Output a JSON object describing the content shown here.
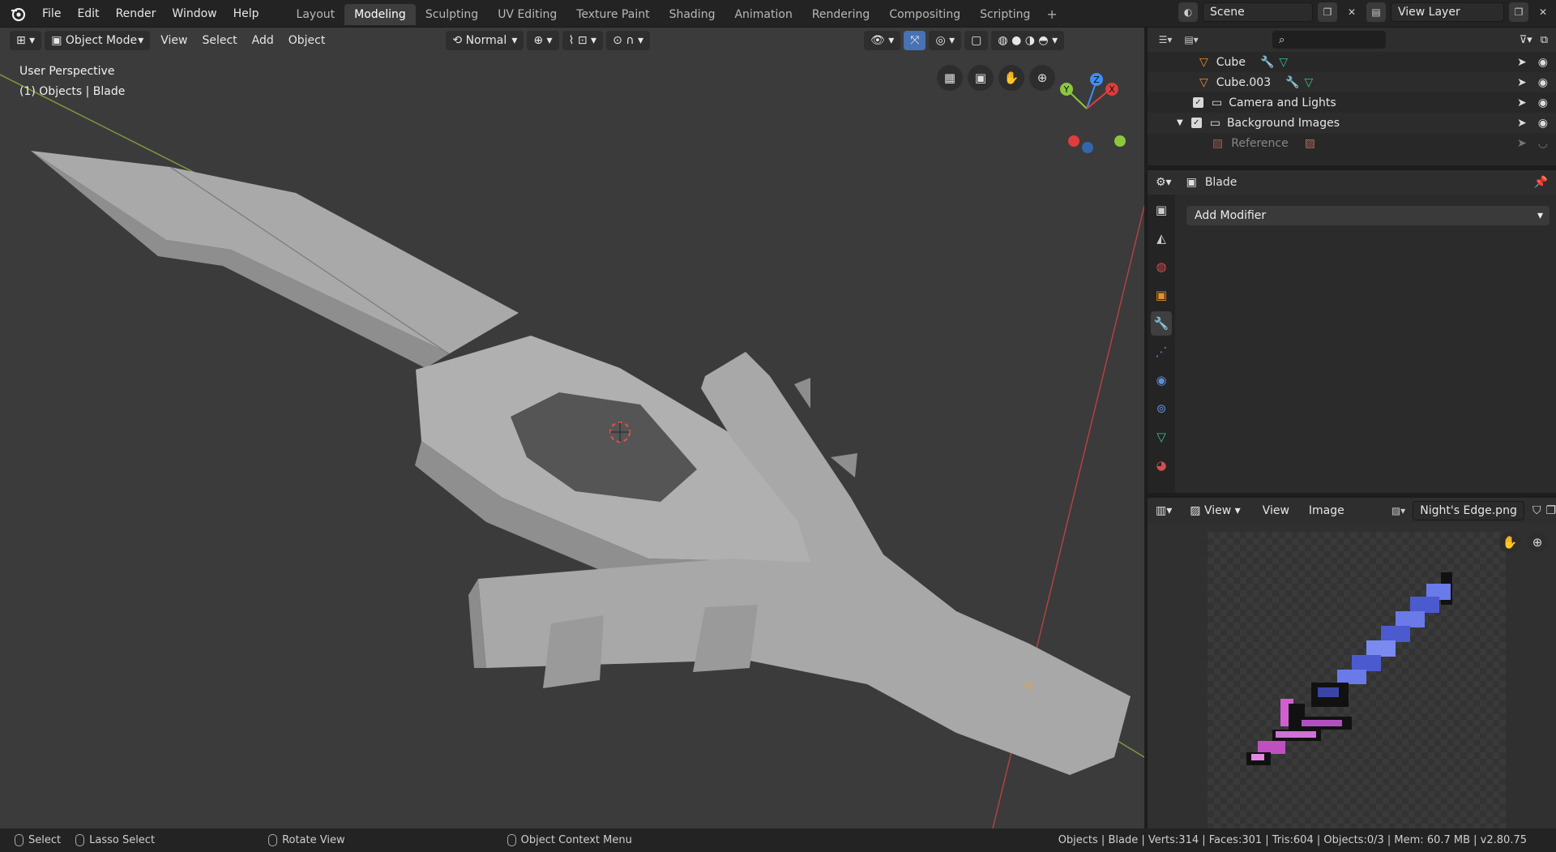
{
  "menu": {
    "file": "File",
    "edit": "Edit",
    "render": "Render",
    "window": "Window",
    "help": "Help"
  },
  "workspaces": [
    "Layout",
    "Modeling",
    "Sculpting",
    "UV Editing",
    "Texture Paint",
    "Shading",
    "Animation",
    "Rendering",
    "Compositing",
    "Scripting"
  ],
  "active_workspace": "Modeling",
  "scene": {
    "name": "Scene",
    "view_layer": "View Layer"
  },
  "viewport": {
    "mode": "Object Mode",
    "menus": {
      "view": "View",
      "select": "Select",
      "add": "Add",
      "object": "Object"
    },
    "transform_orientation": "Normal",
    "perspective": "User Perspective",
    "collection_info": "(1) Objects | Blade",
    "gizmo": {
      "x": "X",
      "y": "Y",
      "z": "Z"
    }
  },
  "outliner": {
    "rows": [
      {
        "name": "Cube"
      },
      {
        "name": "Cube.003"
      },
      {
        "name": "Camera and Lights"
      },
      {
        "name": "Background Images"
      },
      {
        "name": "Reference"
      }
    ]
  },
  "properties": {
    "object_name": "Blade",
    "add_modifier": "Add Modifier"
  },
  "image_editor": {
    "view": "View",
    "view_menu": "View",
    "image_menu": "Image",
    "image_name": "Night's Edge.png"
  },
  "status": {
    "select": "Select",
    "lasso": "Lasso Select",
    "rotate": "Rotate View",
    "context": "Object Context Menu",
    "stats": "Objects | Blade | Verts:314 | Faces:301 | Tris:604 | Objects:0/3 | Mem: 60.7 MB | v2.80.75"
  },
  "colors": {
    "accent": "#4772b3",
    "x_axis": "#e03c3c",
    "y_axis": "#8bc83b",
    "z_axis": "#3f8ef5",
    "mesh": "#b4b4b4",
    "viewport_bg": "#3b3b3b"
  }
}
